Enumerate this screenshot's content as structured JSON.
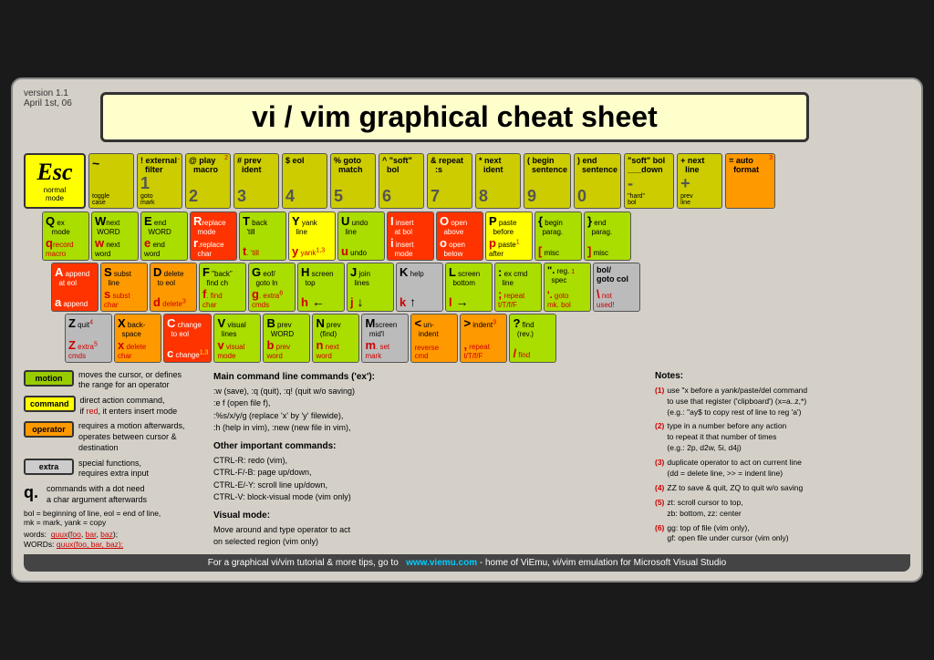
{
  "meta": {
    "version": "version 1.1",
    "date": "April 1st, 06"
  },
  "title": "vi / vim graphical cheat sheet",
  "esc": {
    "key": "Esc",
    "label": "normal\nmode"
  },
  "footer": {
    "text": "For a graphical vi/vim tutorial & more tips, go to",
    "url": "www.viemu.com",
    "suffix": " - home of ViEmu, vi/vim emulation for Microsoft Visual Studio"
  },
  "legend": {
    "motion": {
      "label": "motion",
      "desc": "moves the cursor, or defines\nthe range for an operator"
    },
    "command": {
      "label": "command",
      "desc": "direct action command,\nif red, it enters insert mode"
    },
    "operator": {
      "label": "operator",
      "desc": "requires a motion afterwards,\noperates between cursor &\ndestination"
    },
    "extra": {
      "label": "extra",
      "desc": "special functions,\nrequires extra input"
    },
    "dot": {
      "desc": "commands with a dot need\na char argument afterwards"
    }
  },
  "notes": {
    "title": "Notes:",
    "items": [
      "(1) use \"x before a yank/paste/del command\n    to use that register ('clipboard') (x=a..z,*)\n    (e.g.: \"ay$ to copy rest of line to reg 'a')",
      "(2) type in a number before any action\n    to repeat it that number of times\n    (e.g.: 2p, d2w, 5i, d4j)",
      "(3) duplicate operator to act on current line\n    (dd = delete line, >> = indent line)",
      "(4) ZZ to save & quit, ZQ to quit w/o saving",
      "(5) zt: scroll cursor to top,\n    zb: bottom, zz: center",
      "(6) gg: top of file (vim only),\n    gf: open file under cursor (vim only)"
    ]
  },
  "main_commands": {
    "title": "Main command line commands ('ex'):",
    "items": [
      ":w (save), :q (quit), :q! (quit w/o saving)",
      ":e f (open file f),",
      ":%s/x/y/g (replace 'x' by 'y' filewide),",
      ":h (help in vim), :new (new file in vim),"
    ],
    "other_title": "Other important commands:",
    "other_items": [
      "CTRL-R: redo (vim),",
      "CTRL-F/-B: page up/down,",
      "CTRL-E/-Y: scroll line up/down,",
      "CTRL-V: block-visual mode (vim only)"
    ],
    "visual_title": "Visual mode:",
    "visual_desc": "Move around and type operator to act\non selected region (vim only)"
  },
  "bol_text": "bol = beginning of line, eol = end of line,\nmk = mark, yank = copy",
  "words_text": "words:  quux(foo, bar, baz);",
  "words_text2": "WORDs:  quux(foo, bar, baz);"
}
